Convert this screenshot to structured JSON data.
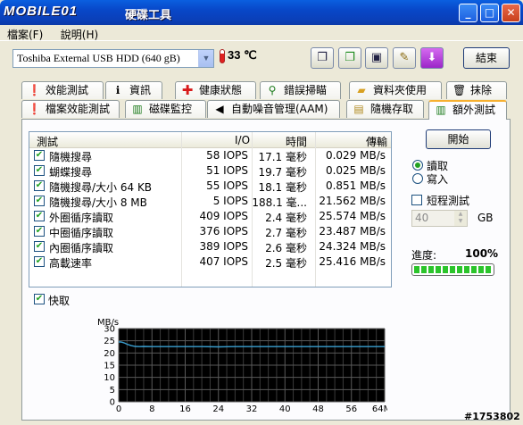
{
  "window": {
    "title_logo": "MOBILE01",
    "title": "硬碟工具",
    "btn_min": "_",
    "btn_max": "□",
    "btn_close": "✕"
  },
  "menu": [
    "檔案(F)",
    "說明(H)"
  ],
  "toolbar": {
    "drive": "Toshiba External USB HDD (640 gB)",
    "temperature": "33 ℃",
    "exit_label": "結束",
    "icons": [
      "copy-icon",
      "copy-green-icon",
      "save-icon",
      "wrench-icon",
      "download-arrow-icon"
    ]
  },
  "tabs_row1": [
    {
      "label": "效能測試",
      "icon": "info-yellow-icon"
    },
    {
      "label": "資訊",
      "icon": "info-black-icon"
    },
    {
      "label": "健康狀態",
      "icon": "health-cross-icon"
    },
    {
      "label": "錯誤掃瞄",
      "icon": "magnifier-icon"
    },
    {
      "label": "資料夾使用",
      "icon": "folder-icon"
    },
    {
      "label": "抹除",
      "icon": "trash-icon"
    }
  ],
  "tabs_row2": [
    {
      "label": "檔案效能測試",
      "icon": "file-info-icon"
    },
    {
      "label": "磁碟監控",
      "icon": "chart-icon"
    },
    {
      "label": "自動噪音管理(AAM)",
      "icon": "speaker-icon"
    },
    {
      "label": "隨機存取",
      "icon": "random-icon"
    },
    {
      "label": "額外測試",
      "icon": "extra-test-icon",
      "active": true
    }
  ],
  "table": {
    "columns": [
      "測試",
      "I/O",
      "時間",
      "傳輸"
    ],
    "rows": [
      {
        "checked": true,
        "test": "隨機搜尋",
        "io": "58 IOPS",
        "time": "17.1 毫秒",
        "transfer": "0.029 MB/s"
      },
      {
        "checked": true,
        "test": "蝴蝶搜尋",
        "io": "51 IOPS",
        "time": "19.7 毫秒",
        "transfer": "0.025 MB/s"
      },
      {
        "checked": true,
        "test": "隨機搜尋/大小 64 KB",
        "io": "55 IOPS",
        "time": "18.1 毫秒",
        "transfer": "0.851 MB/s"
      },
      {
        "checked": true,
        "test": "隨機搜尋/大小 8 MB",
        "io": "5 IOPS",
        "time": "188.1 毫...",
        "transfer": "21.562 MB/s"
      },
      {
        "checked": true,
        "test": "外圈循序讀取",
        "io": "409 IOPS",
        "time": "2.4 毫秒",
        "transfer": "25.574 MB/s"
      },
      {
        "checked": true,
        "test": "中圈循序讀取",
        "io": "376 IOPS",
        "time": "2.7 毫秒",
        "transfer": "23.487 MB/s"
      },
      {
        "checked": true,
        "test": "內圈循序讀取",
        "io": "389 IOPS",
        "time": "2.6 毫秒",
        "transfer": "24.324 MB/s"
      },
      {
        "checked": true,
        "test": "高載速率",
        "io": "407 IOPS",
        "time": "2.5 毫秒",
        "transfer": "25.416 MB/s"
      }
    ]
  },
  "side": {
    "start_label": "開始",
    "read_label": "讀取",
    "write_label": "寫入",
    "mode": "read",
    "short_test_label": "短程測試",
    "short_test_checked": false,
    "size_value": "40",
    "size_unit": "GB",
    "progress_label": "進度:",
    "progress_value": "100%",
    "progress_fraction": 1.0
  },
  "fast_label": "快取",
  "fast_checked": true,
  "watermark": "#1753802",
  "chart_data": {
    "type": "line",
    "ylabel": "MB/s",
    "yticks": [
      0,
      5,
      10,
      15,
      20,
      25,
      30
    ],
    "ylim": [
      0,
      30
    ],
    "xticks": [
      "0",
      "8",
      "16",
      "24",
      "32",
      "40",
      "48",
      "56",
      "64MB"
    ],
    "xlim": [
      0,
      64
    ],
    "grid": true,
    "series": [
      {
        "color": "#3a9fd0",
        "x": [
          0,
          0.5,
          1,
          1.5,
          2,
          3,
          4,
          5,
          6,
          8,
          10,
          12,
          16,
          20,
          24,
          28,
          32,
          36,
          40,
          44,
          48,
          52,
          56,
          60,
          64
        ],
        "values": [
          24.5,
          24.5,
          24.3,
          24.0,
          23.6,
          23.0,
          22.7,
          22.6,
          22.7,
          22.6,
          22.6,
          22.6,
          22.6,
          22.6,
          22.5,
          22.6,
          22.6,
          22.6,
          22.6,
          22.6,
          22.6,
          22.6,
          22.6,
          22.6,
          22.6
        ]
      }
    ]
  }
}
